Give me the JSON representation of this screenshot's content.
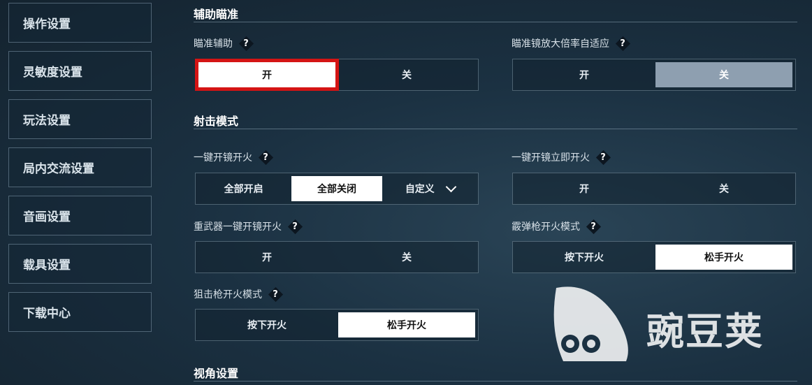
{
  "sidebar": {
    "items": [
      {
        "label": "操作设置"
      },
      {
        "label": "灵敏度设置"
      },
      {
        "label": "玩法设置"
      },
      {
        "label": "局内交流设置"
      },
      {
        "label": "音画设置"
      },
      {
        "label": "载具设置"
      },
      {
        "label": "下载中心"
      }
    ]
  },
  "sections": {
    "aim_assist_title": "辅助瞄准",
    "fire_mode_title": "射击模式",
    "view_title": "视角设置"
  },
  "settings": {
    "aim_assist": {
      "label": "瞄准辅助",
      "on": "开",
      "off": "关",
      "selected": "开"
    },
    "scope_adaptive": {
      "label": "瞄准镜放大倍率自适应",
      "on": "开",
      "off": "关",
      "selected": "关"
    },
    "one_key_scope_fire": {
      "label": "一键开镜开火",
      "options": [
        "全部开启",
        "全部关闭",
        "自定义"
      ],
      "selected": "全部关闭"
    },
    "instant_scope_fire": {
      "label": "一键开镜立即开火",
      "on": "开",
      "off": "关"
    },
    "heavy_weapon_fire": {
      "label": "重武器一键开镜开火",
      "on": "开",
      "off": "关"
    },
    "shotgun_fire_mode": {
      "label": "霰弹枪开火模式",
      "press": "按下开火",
      "release": "松手开火",
      "selected": "松手开火"
    },
    "sniper_fire_mode": {
      "label": "狙击枪开火模式",
      "press": "按下开火",
      "release": "松手开火",
      "selected": "松手开火"
    }
  },
  "help_icon": "?",
  "watermark": {
    "text": "豌豆荚"
  },
  "colors": {
    "highlight": "#d41414",
    "selected": "#ffffff",
    "selected_dim": "#8e9fb0"
  }
}
